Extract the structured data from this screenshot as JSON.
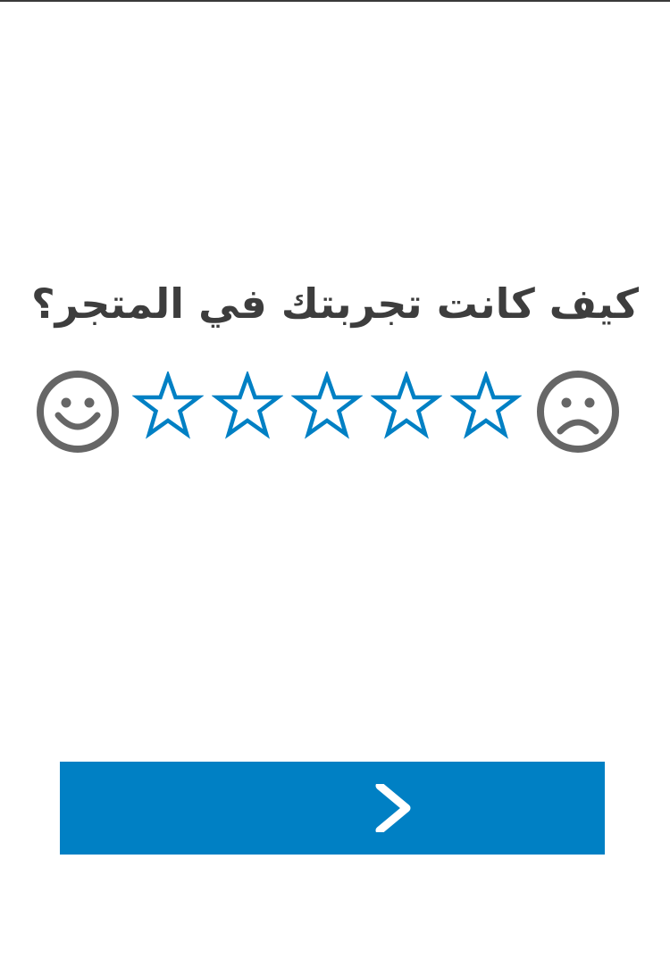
{
  "survey": {
    "question": "كيف كانت تجربتك في المتجر؟",
    "scale_min_icon": "happy-face-icon",
    "scale_max_icon": "sad-face-icon",
    "stars": [
      {
        "icon": "star-outline-icon"
      },
      {
        "icon": "star-outline-icon"
      },
      {
        "icon": "star-outline-icon"
      },
      {
        "icon": "star-outline-icon"
      },
      {
        "icon": "star-outline-icon"
      }
    ],
    "selected_rating": 0,
    "max_rating": 5
  },
  "next_button": {
    "icon": "chevron-right-icon"
  },
  "colors": {
    "accent": "#0080c4",
    "face": "#666666",
    "text": "#3d3d3d",
    "background": "#ffffff"
  }
}
